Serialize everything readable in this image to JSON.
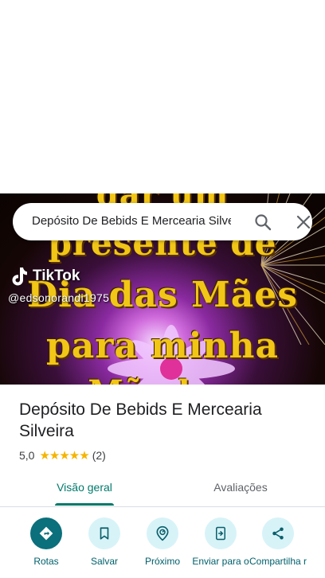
{
  "search": {
    "value": "Depósito De Bebids E Mercearia Silveira"
  },
  "photo": {
    "overlay_lines": [
      "dar um",
      "presente de",
      "Dia das Mães",
      "para minha",
      "Mãe b..."
    ],
    "watermark_brand": "TikTok",
    "watermark_user": "@edsonorandi1975"
  },
  "place": {
    "title": "Depósito De Bebids E Mercearia Silveira",
    "rating": "5,0",
    "stars": "★★★★★",
    "review_count": "(2)"
  },
  "tabs": [
    {
      "label": "Visão geral",
      "selected": true
    },
    {
      "label": "Avaliações",
      "selected": false
    }
  ],
  "actions": [
    {
      "label": "Rotas",
      "icon": "directions-icon"
    },
    {
      "label": "Salvar",
      "icon": "bookmark-icon"
    },
    {
      "label": "Próximo",
      "icon": "nearby-icon"
    },
    {
      "label": "Enviar para o",
      "icon": "send-to-phone-icon"
    },
    {
      "label": "Compartilha r",
      "icon": "share-icon"
    }
  ],
  "colors": {
    "accent": "#00796b",
    "primary_action": "#0b6f7c",
    "action_bg": "#d7f3f8",
    "star": "#f5b400",
    "overlay_text": "#f2c617"
  }
}
